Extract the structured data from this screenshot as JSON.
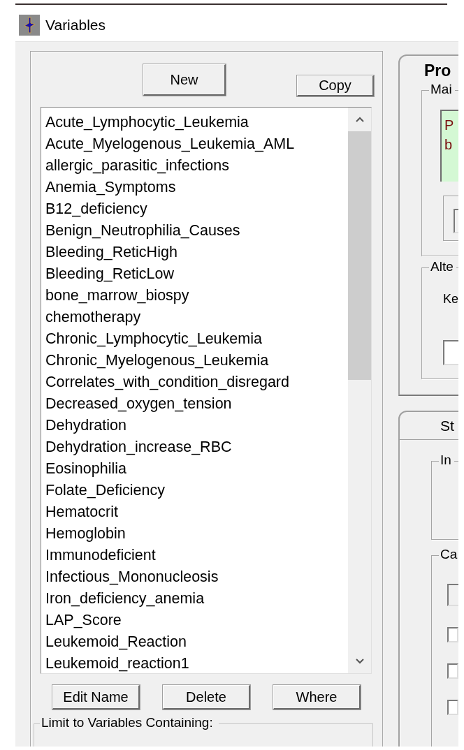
{
  "window": {
    "title": "Variables"
  },
  "variables_panel": {
    "new_button": "New",
    "copy_button": "Copy",
    "list": [
      {
        "label": "Acute_Lymphocytic_Leukemia",
        "selected": false
      },
      {
        "label": "Acute_Myelogenous_Leukemia_AML",
        "selected": false
      },
      {
        "label": "allergic_parasitic_infections",
        "selected": false
      },
      {
        "label": "Anemia_Symptoms",
        "selected": false
      },
      {
        "label": "B12_deficiency",
        "selected": false
      },
      {
        "label": "Benign_Neutrophilia_Causes",
        "selected": false
      },
      {
        "label": "Bleeding_ReticHigh",
        "selected": false
      },
      {
        "label": "Bleeding_ReticLow",
        "selected": false
      },
      {
        "label": "bone_marrow_biospy",
        "selected": false
      },
      {
        "label": "chemotherapy",
        "selected": false
      },
      {
        "label": "Chronic_Lymphocytic_Leukemia",
        "selected": false
      },
      {
        "label": "Chronic_Myelogenous_Leukemia",
        "selected": false
      },
      {
        "label": "Correlates_with_condition_disregard",
        "selected": false
      },
      {
        "label": "Decreased_oxygen_tension",
        "selected": false
      },
      {
        "label": "Dehydration",
        "selected": false
      },
      {
        "label": "Dehydration_increase_RBC",
        "selected": false
      },
      {
        "label": "Eosinophilia",
        "selected": false
      },
      {
        "label": "Folate_Deficiency",
        "selected": false
      },
      {
        "label": "Hematocrit",
        "selected": false
      },
      {
        "label": "Hemoglobin",
        "selected": false
      },
      {
        "label": "Immunodeficient",
        "selected": false
      },
      {
        "label": "Infectious_Mononucleosis",
        "selected": false
      },
      {
        "label": "Iron_deficiency_anemia",
        "selected": false
      },
      {
        "label": "LAP_Score",
        "selected": false
      },
      {
        "label": "Leukemoid_Reaction",
        "selected": false
      },
      {
        "label": "Leukemoid_reaction1",
        "selected": false
      }
    ],
    "bottom_buttons": [
      "Edit Name",
      "Delete",
      "Where"
    ],
    "filter_group": {
      "label": "Limit to Variables Containing:"
    }
  },
  "properties_panel": {
    "title": "Pro",
    "main_group": {
      "label": "Mai",
      "text_lines": [
        "P",
        "b"
      ]
    },
    "alt_group": {
      "label": "Alte",
      "text": "Ke"
    }
  },
  "lower_tab": {
    "label": "St",
    "groups": [
      {
        "label": "In"
      },
      {
        "label": "Ca",
        "controls": [
          {
            "kind": "field"
          },
          {
            "kind": "checkbox",
            "checked": false
          },
          {
            "kind": "checkbox",
            "checked": false
          },
          {
            "kind": "checkbox",
            "checked": false
          }
        ]
      }
    ]
  }
}
